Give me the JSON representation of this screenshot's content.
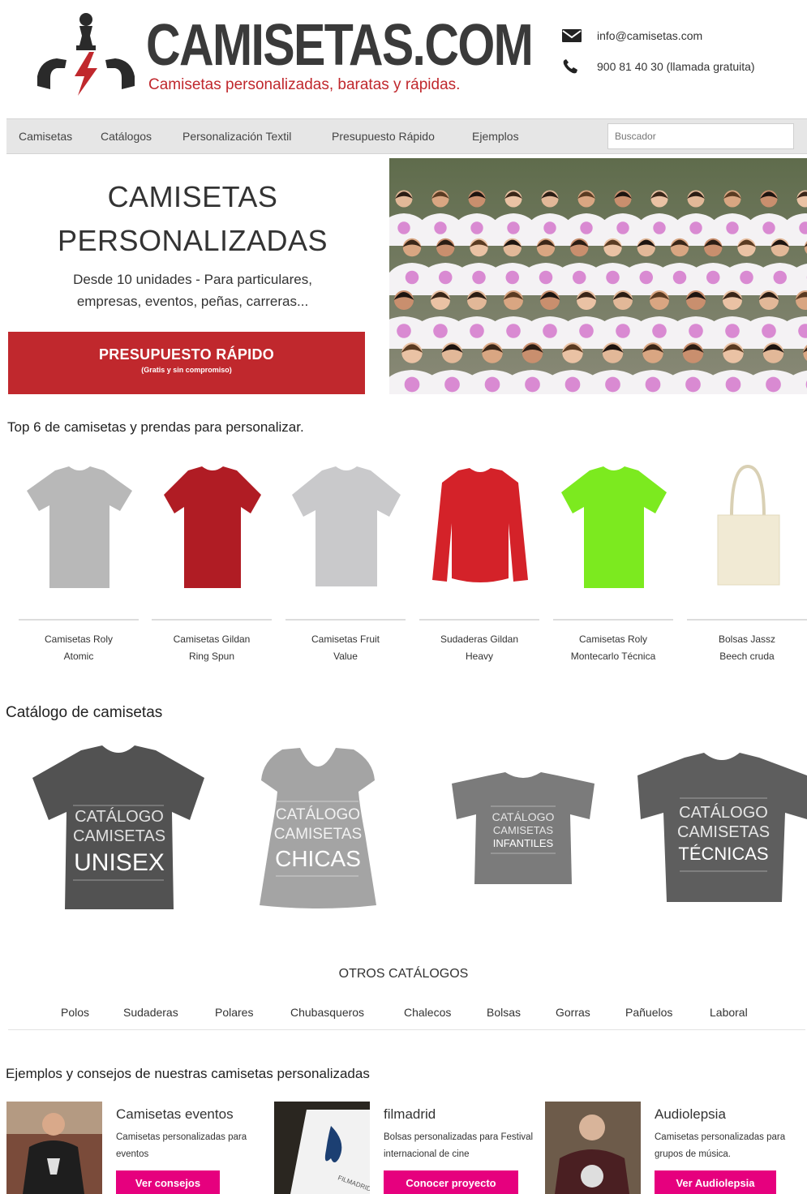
{
  "header": {
    "logo_text": "CAMISETAS.COM",
    "tagline": "Camisetas personalizadas, baratas y rápidas.",
    "email": "info@camisetas.com",
    "phone": "900 81 40 30 (llamada gratuita)"
  },
  "nav": {
    "items": [
      "Camisetas",
      "Catálogos",
      "Personalización Textil",
      "Presupuesto Rápido",
      "Ejemplos"
    ],
    "search_placeholder": "Buscador"
  },
  "hero": {
    "title_line1": "CAMISETAS",
    "title_line2": "PERSONALIZADAS",
    "subtitle_line1": "Desde 10 unidades - Para particulares,",
    "subtitle_line2": "empresas, eventos, peñas, carreras...",
    "cta_label": "PRESUPUESTO RÁPIDO",
    "cta_sub": "(Gratis y sin compromiso)"
  },
  "top6": {
    "title": "Top 6 de camisetas y prendas para personalizar.",
    "products": [
      {
        "line1": "Camisetas Roly",
        "line2": "Atomic",
        "color": "#b8b8b8"
      },
      {
        "line1": "Camisetas Gildan",
        "line2": "Ring Spun",
        "color": "#b01c24"
      },
      {
        "line1": "Camisetas Fruit",
        "line2": "Value",
        "color": "#c9c9cb"
      },
      {
        "line1": "Sudaderas Gildan",
        "line2": "Heavy",
        "color": "#d42229"
      },
      {
        "line1": "Camisetas Roly",
        "line2": "Montecarlo Técnica",
        "color": "#7cea1f"
      },
      {
        "line1": "Bolsas Jassz",
        "line2": "Beech cruda",
        "color": "#f1ead4"
      }
    ]
  },
  "catalog": {
    "title": "Catálogo de camisetas",
    "items": [
      {
        "l1": "CATÁLOGO",
        "l2": "CAMISETAS",
        "l3": "UNISEX"
      },
      {
        "l1": "CATÁLOGO",
        "l2": "CAMISETAS",
        "l3": "CHICAS"
      },
      {
        "l1": "CATÁLOGO",
        "l2": "CAMISETAS",
        "l3": "INFANTILES"
      },
      {
        "l1": "CATÁLOGO",
        "l2": "CAMISETAS",
        "l3": "TÉCNICAS"
      }
    ]
  },
  "otros": {
    "title": "OTROS CATÁLOGOS",
    "items": [
      "Polos",
      "Sudaderas",
      "Polares",
      "Chubasqueros",
      "Chalecos",
      "Bolsas",
      "Gorras",
      "Pañuelos",
      "Laboral"
    ]
  },
  "examples": {
    "title": "Ejemplos y consejos de nuestras camisetas personalizadas",
    "items": [
      {
        "title": "Camisetas eventos",
        "desc": "Camisetas personalizadas para eventos",
        "button": "Ver consejos"
      },
      {
        "title": "filmadrid",
        "desc": "Bolsas personalizadas para Festival internacional de cine",
        "button": "Conocer proyecto"
      },
      {
        "title": "Audiolepsia",
        "desc": "Camisetas personalizadas para grupos de música.",
        "button": "Ver Audiolepsia"
      }
    ]
  },
  "colors": {
    "brand_red": "#c0282d",
    "accent_pink": "#e6007e",
    "nav_gray": "#e6e6e6"
  }
}
